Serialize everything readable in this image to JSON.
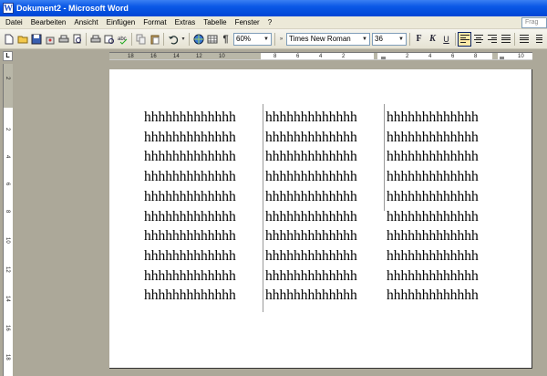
{
  "window": {
    "title": "Dokument2 - Microsoft Word",
    "app_icon_glyph": "W"
  },
  "menu": {
    "items": [
      "Datei",
      "Bearbeiten",
      "Ansicht",
      "Einfügen",
      "Format",
      "Extras",
      "Tabelle",
      "Fenster",
      "?"
    ],
    "help_box_text": "Frag"
  },
  "toolbar": {
    "icons": [
      "new-icon",
      "open-icon",
      "save-icon",
      "permission-icon",
      "print-icon",
      "print-preview-icon",
      "spelling-icon",
      "copy-icon",
      "paste-icon",
      "undo-icon",
      "hyperlink-icon",
      "table-icon",
      "show-formatting-icon"
    ],
    "paragraph_mark": "¶",
    "zoom": "60%",
    "font_name": "Times New Roman",
    "font_size": "36",
    "bold": "F",
    "italic": "K",
    "underline": "U"
  },
  "ruler": {
    "horizontal_numbers": [
      "18",
      "16",
      "14",
      "12",
      "10",
      "8",
      "6",
      "4",
      "2",
      "2",
      "4",
      "6",
      "8",
      "10"
    ],
    "vertical_numbers": [
      "2",
      "2",
      "4",
      "6",
      "8",
      "10",
      "12",
      "14",
      "16",
      "18"
    ]
  },
  "document": {
    "columns": [
      [
        "hhhhhhhhhhhhh",
        "hhhhhhhhhhhhh",
        "hhhhhhhhhhhhh",
        "hhhhhhhhhhhhh",
        "hhhhhhhhhhhhh",
        "hhhhhhhhhhhhh",
        "hhhhhhhhhhhhh",
        "hhhhhhhhhhhhh",
        "hhhhhhhhhhhhh",
        "hhhhhhhhhhhhh"
      ],
      [
        "hhhhhhhhhhhhh",
        "hhhhhhhhhhhhh",
        "hhhhhhhhhhhhh",
        "hhhhhhhhhhhhh",
        "hhhhhhhhhhhhh",
        "hhhhhhhhhhhhh",
        "hhhhhhhhhhhhh",
        "hhhhhhhhhhhhh",
        "hhhhhhhhhhhhh",
        "hhhhhhhhhhhhh"
      ],
      [
        "hhhhhhhhhhhhh",
        "hhhhhhhhhhhhh",
        "hhhhhhhhhhhhh",
        "hhhhhhhhhhhhh",
        "hhhhhhhhhhhhh",
        "hhhhhhhhhhhhh",
        "hhhhhhhhhhhhh",
        "hhhhhhhhhhhhh",
        "hhhhhhhhhhhhh",
        "hhhhhhhhhhhhh"
      ]
    ]
  },
  "colors": {
    "titlebar": "#0a58e6",
    "chrome": "#ece9d8",
    "workspace": "#aca899"
  }
}
